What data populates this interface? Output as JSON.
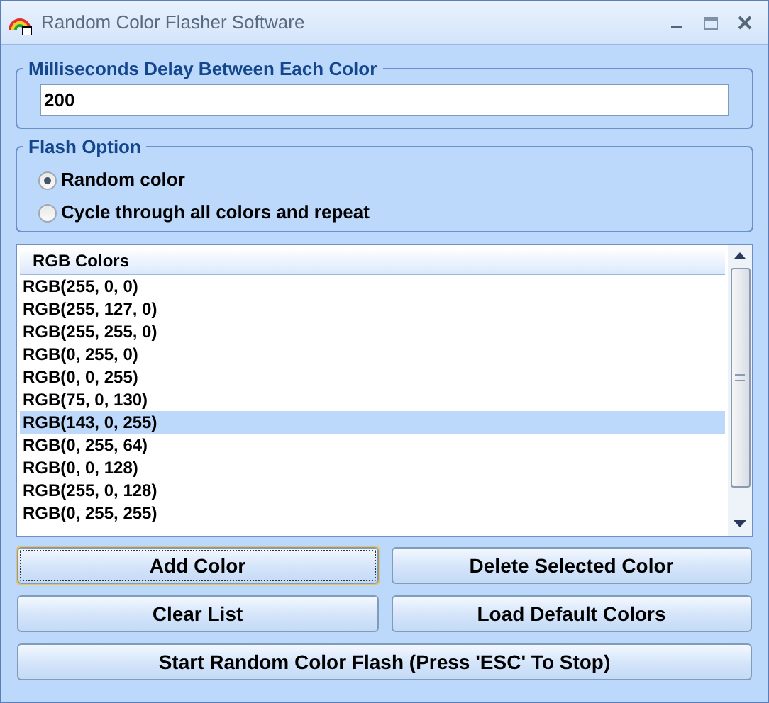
{
  "window": {
    "title": "Random Color Flasher Software"
  },
  "delay_group": {
    "title": "Milliseconds Delay Between Each Color",
    "value": "200"
  },
  "flash_group": {
    "title": "Flash Option",
    "options": [
      {
        "label": "Random color",
        "selected": true
      },
      {
        "label": "Cycle through all colors and repeat",
        "selected": false
      }
    ]
  },
  "list": {
    "header": "RGB Colors",
    "rows": [
      {
        "text": "RGB(255, 0, 0)",
        "selected": false
      },
      {
        "text": "RGB(255, 127, 0)",
        "selected": false
      },
      {
        "text": "RGB(255, 255, 0)",
        "selected": false
      },
      {
        "text": "RGB(0, 255, 0)",
        "selected": false
      },
      {
        "text": "RGB(0, 0, 255)",
        "selected": false
      },
      {
        "text": "RGB(75, 0, 130)",
        "selected": false
      },
      {
        "text": "RGB(143, 0, 255)",
        "selected": true
      },
      {
        "text": "RGB(0, 255, 64)",
        "selected": false
      },
      {
        "text": "RGB(0, 0, 128)",
        "selected": false
      },
      {
        "text": "RGB(255, 0, 128)",
        "selected": false
      },
      {
        "text": "RGB(0, 255, 255)",
        "selected": false
      }
    ]
  },
  "buttons": [
    {
      "label": "Add Color",
      "focused": true
    },
    {
      "label": "Delete Selected Color",
      "focused": false
    },
    {
      "label": "Clear List",
      "focused": false
    },
    {
      "label": "Load Default Colors",
      "focused": false
    }
  ],
  "start_button": {
    "label": "Start Random Color Flash (Press 'ESC' To Stop)"
  }
}
